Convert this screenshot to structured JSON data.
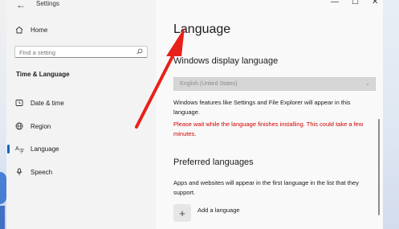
{
  "window": {
    "app_title": "Settings",
    "back_icon": "back-arrow-icon",
    "controls": [
      "minimize-icon",
      "maximize-icon",
      "close-icon"
    ]
  },
  "sidebar": {
    "home_label": "Home",
    "search_placeholder": "Find a setting",
    "section_title": "Time & Language",
    "items": [
      {
        "label": "Date & time",
        "icon": "clock-icon"
      },
      {
        "label": "Region",
        "icon": "globe-icon"
      },
      {
        "label": "Language",
        "icon": "language-icon",
        "active": true
      },
      {
        "label": "Speech",
        "icon": "microphone-icon"
      }
    ]
  },
  "main": {
    "page_title": "Language",
    "display_language": {
      "heading": "Windows display language",
      "selected": "English (United States)",
      "description": "Windows features like Settings and File Explorer will appear in this language.",
      "warning": "Please wait while the language finishes installing. This could take a few minutes."
    },
    "preferred": {
      "heading": "Preferred languages",
      "description": "Apps and websites will appear in the first language in the list that they support.",
      "add_label": "Add a language"
    }
  },
  "annotation": {
    "arrow_color": "#e8201a"
  },
  "colors": {
    "accent": "#0067c0",
    "warning": "#d10000"
  }
}
